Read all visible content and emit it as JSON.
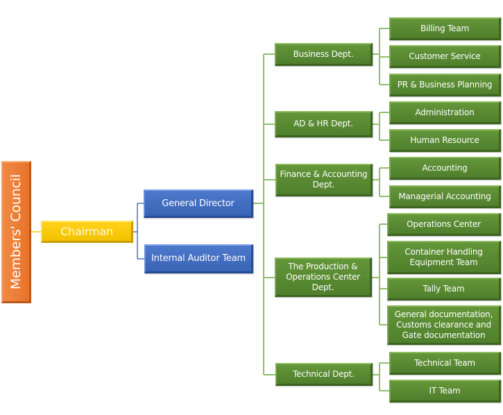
{
  "colors": {
    "council": "#ec7a34",
    "chairman": "#f9ca06",
    "executive": "#4370c4",
    "department": "#5a8a33",
    "connector_blue": "#4a72c0",
    "connector_green": "#8fbf66",
    "connector_yellow": "#f5c800"
  },
  "council": {
    "label": "Members' Council"
  },
  "chairman": {
    "label": "Chairman"
  },
  "executives": [
    {
      "label": "General Director"
    },
    {
      "label": "Internal Auditor Team"
    }
  ],
  "departments": [
    {
      "label": "Business  Dept.",
      "teams": [
        {
          "label": "Billing Team"
        },
        {
          "label": "Customer  Service"
        },
        {
          "label": "PR & Business  Planning"
        }
      ]
    },
    {
      "label": "AD & HR Dept.",
      "teams": [
        {
          "label": "Administration"
        },
        {
          "label": "Human Resource"
        }
      ]
    },
    {
      "label": "Finance & Accounting Dept.",
      "teams": [
        {
          "label": "Accounting"
        },
        {
          "label": "Managerial Accounting"
        }
      ]
    },
    {
      "label": "The Production  & Operations Center Dept.",
      "teams": [
        {
          "label": "Operations Center"
        },
        {
          "label": "Container Handling Equipment Team"
        },
        {
          "label": "Tally Team"
        },
        {
          "label": "General documentation, Customs  clearance and Gate documentation"
        }
      ]
    },
    {
      "label": "Technical Dept.",
      "teams": [
        {
          "label": "Technical Team"
        },
        {
          "label": "IT Team"
        }
      ]
    }
  ]
}
